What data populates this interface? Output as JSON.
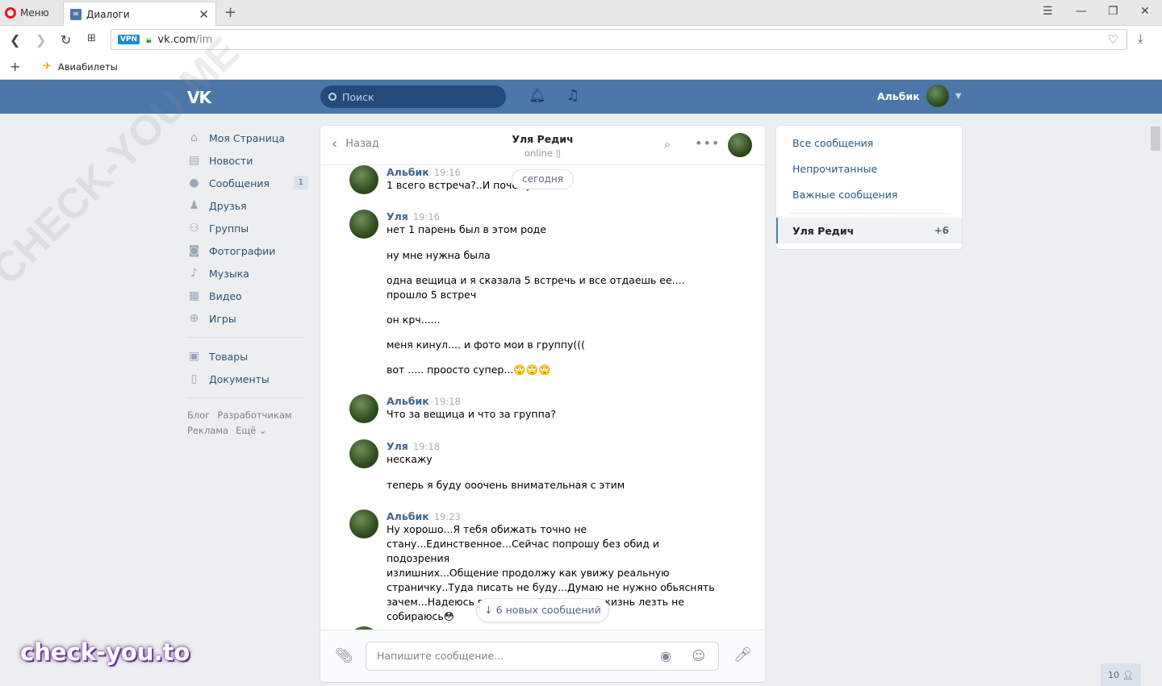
{
  "browser": {
    "menu_label": "Меню",
    "tab_title": "Диалоги",
    "vpn_label": "VPN",
    "url_host": "vk.com",
    "url_path": "/im",
    "bookmark_label": "Авиабилеты"
  },
  "vk": {
    "logo": "VK",
    "search_placeholder": "Поиск",
    "user_name": "Альбик"
  },
  "leftnav": {
    "items": [
      {
        "label": "Моя Страница",
        "icon": "home-icon"
      },
      {
        "label": "Новости",
        "icon": "news-icon"
      },
      {
        "label": "Сообщения",
        "icon": "messages-icon",
        "badge": "1"
      },
      {
        "label": "Друзья",
        "icon": "friends-icon"
      },
      {
        "label": "Группы",
        "icon": "groups-icon"
      },
      {
        "label": "Фотографии",
        "icon": "camera-icon"
      },
      {
        "label": "Музыка",
        "icon": "music-icon"
      },
      {
        "label": "Видео",
        "icon": "video-icon"
      },
      {
        "label": "Игры",
        "icon": "games-icon"
      }
    ],
    "items2": [
      {
        "label": "Товары",
        "icon": "goods-icon"
      },
      {
        "label": "Документы",
        "icon": "document-icon"
      }
    ],
    "footer": [
      "Блог",
      "Разработчикам",
      "Реклама",
      "Ещё ⌄"
    ]
  },
  "chat": {
    "back_label": "Назад",
    "peer_name": "Уля Редич",
    "peer_status": "online",
    "date_divider": "сегодня",
    "new_messages": "6 новых сообщений",
    "input_placeholder": "Напишите сообщение...",
    "messages": [
      {
        "author": "Альбик",
        "time": "19:16",
        "lines": [
          "1 всего встреча?..И почему.."
        ]
      },
      {
        "author": "Уля",
        "time": "19:16",
        "lines": [
          "нет 1 парень был в этом роде"
        ]
      },
      {
        "lines": [
          "ну мне нужна была"
        ]
      },
      {
        "lines": [
          "одна вещица и я сказала 5 встречь и все отдаешь ее....",
          "прошло 5 встреч"
        ]
      },
      {
        "lines": [
          "он крч......"
        ]
      },
      {
        "lines": [
          "меня кинул.... и фото мои в группу((("
        ]
      },
      {
        "lines": [
          "вот ..... проосто супер...🙄🙄🙄"
        ]
      },
      {
        "author": "Альбик",
        "time": "19:18",
        "lines": [
          "Что за вещица и что за группа?"
        ]
      },
      {
        "author": "Уля",
        "time": "19:18",
        "lines": [
          "нескажу"
        ]
      },
      {
        "lines": [
          "теперь я буду ооочень внимательная с этим"
        ]
      },
      {
        "author": "Альбик",
        "time": "19:23",
        "lines": [
          "Ну хорошо...Я тебя обижать точно не",
          "стану...Единственное...Сейчас попрошу без обид и подозрения",
          "излишних...Общение продолжу как увижу реальную",
          "страничку..Туда писать не буду...Думаю не нужно обьяснять",
          "зачем...Надеюсь понимаешь...В личную жизнь лезть не",
          "собираюсь😳"
        ]
      }
    ]
  },
  "rmenu": {
    "items": [
      "Все сообщения",
      "Непрочитанные",
      "Важные сообщения"
    ],
    "active_name": "Уля Редич",
    "active_count": "+6"
  },
  "misc": {
    "online_count": "10",
    "watermark": "check-you.to",
    "diag_watermark": "CHECK-YOU.ME"
  }
}
